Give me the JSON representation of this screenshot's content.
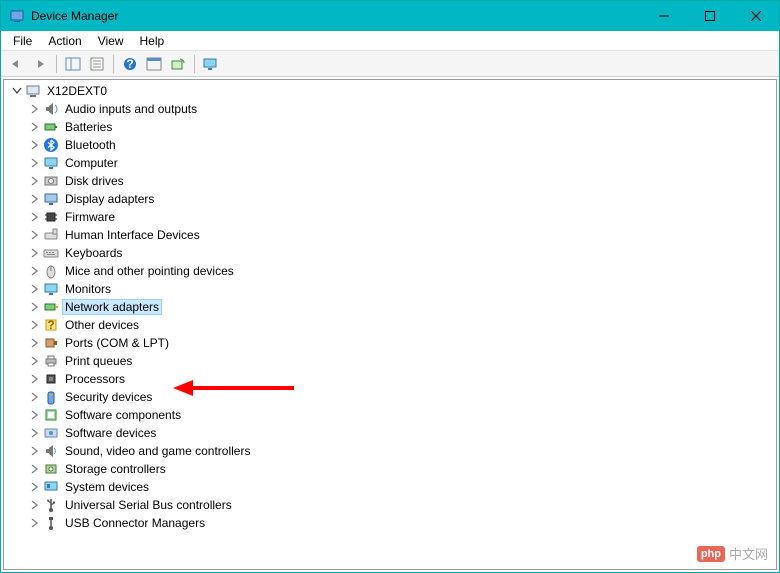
{
  "window": {
    "title": "Device Manager"
  },
  "menu": {
    "file": "File",
    "action": "Action",
    "view": "View",
    "help": "Help"
  },
  "toolbar": {
    "back": "Back",
    "forward": "Forward",
    "show_hide": "Show/Hide Console Tree",
    "properties": "Properties",
    "help": "Help",
    "action_center": "Actions",
    "scan": "Scan for hardware changes",
    "monitor": "Device views"
  },
  "tree": {
    "root": {
      "label": "X12DEXT0",
      "expanded": true,
      "children": [
        {
          "id": "audio",
          "label": "Audio inputs and outputs",
          "icon": "speaker-icon"
        },
        {
          "id": "batteries",
          "label": "Batteries",
          "icon": "battery-icon"
        },
        {
          "id": "bluetooth",
          "label": "Bluetooth",
          "icon": "bluetooth-icon"
        },
        {
          "id": "computer",
          "label": "Computer",
          "icon": "monitor-icon"
        },
        {
          "id": "disk",
          "label": "Disk drives",
          "icon": "disk-icon"
        },
        {
          "id": "display",
          "label": "Display adapters",
          "icon": "display-icon"
        },
        {
          "id": "firmware",
          "label": "Firmware",
          "icon": "chip-icon"
        },
        {
          "id": "hid",
          "label": "Human Interface Devices",
          "icon": "hid-icon"
        },
        {
          "id": "keyboards",
          "label": "Keyboards",
          "icon": "keyboard-icon"
        },
        {
          "id": "mice",
          "label": "Mice and other pointing devices",
          "icon": "mouse-icon"
        },
        {
          "id": "monitors",
          "label": "Monitors",
          "icon": "monitor2-icon"
        },
        {
          "id": "network",
          "label": "Network adapters",
          "icon": "network-icon",
          "selected": true
        },
        {
          "id": "other",
          "label": "Other devices",
          "icon": "other-icon"
        },
        {
          "id": "ports",
          "label": "Ports (COM & LPT)",
          "icon": "port-icon"
        },
        {
          "id": "printq",
          "label": "Print queues",
          "icon": "printer-icon"
        },
        {
          "id": "proc",
          "label": "Processors",
          "icon": "cpu-icon"
        },
        {
          "id": "security",
          "label": "Security devices",
          "icon": "security-icon"
        },
        {
          "id": "swcomp",
          "label": "Software components",
          "icon": "swcomp-icon"
        },
        {
          "id": "swdev",
          "label": "Software devices",
          "icon": "swdev-icon"
        },
        {
          "id": "sound",
          "label": "Sound, video and game controllers",
          "icon": "sound-icon"
        },
        {
          "id": "storage",
          "label": "Storage controllers",
          "icon": "storage-icon"
        },
        {
          "id": "system",
          "label": "System devices",
          "icon": "system-icon"
        },
        {
          "id": "usb",
          "label": "Universal Serial Bus controllers",
          "icon": "usb-icon"
        },
        {
          "id": "usbconn",
          "label": "USB Connector Managers",
          "icon": "usbconn-icon"
        }
      ]
    }
  },
  "annotation": {
    "arrow_color": "#ff0000",
    "target": "Network adapters"
  },
  "watermark": {
    "badge": "php",
    "text": "中文网"
  }
}
